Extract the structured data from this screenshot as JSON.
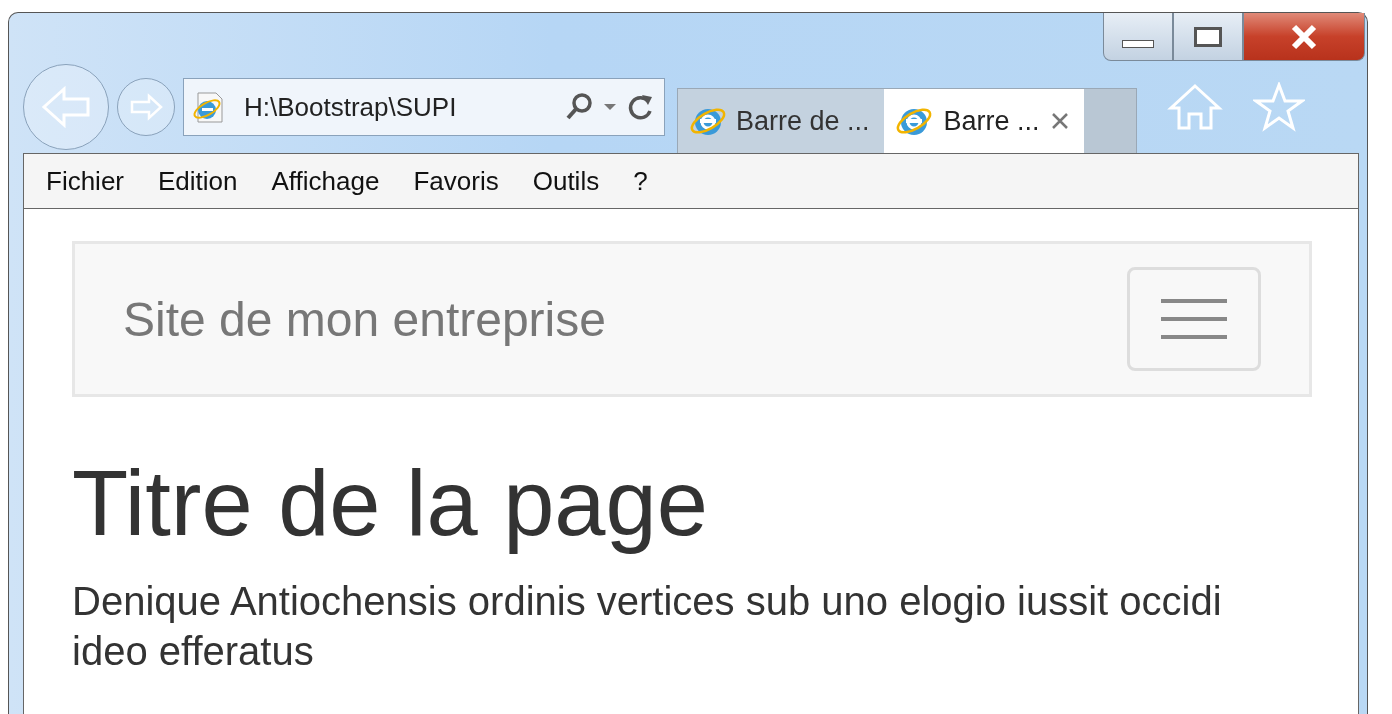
{
  "address_bar": {
    "value": "H:\\Bootstrap\\SUPI"
  },
  "tabs": [
    {
      "label": "Barre de ...",
      "selected": false
    },
    {
      "label": "Barre ...",
      "selected": true
    }
  ],
  "menu_bar": [
    "Fichier",
    "Edition",
    "Affichage",
    "Favoris",
    "Outils",
    "?"
  ],
  "navbar": {
    "brand": "Site de mon entreprise"
  },
  "page": {
    "heading": "Titre de la page",
    "paragraph": "Denique Antiochensis ordinis vertices sub uno elogio iussit occidi ideo efferatus"
  }
}
